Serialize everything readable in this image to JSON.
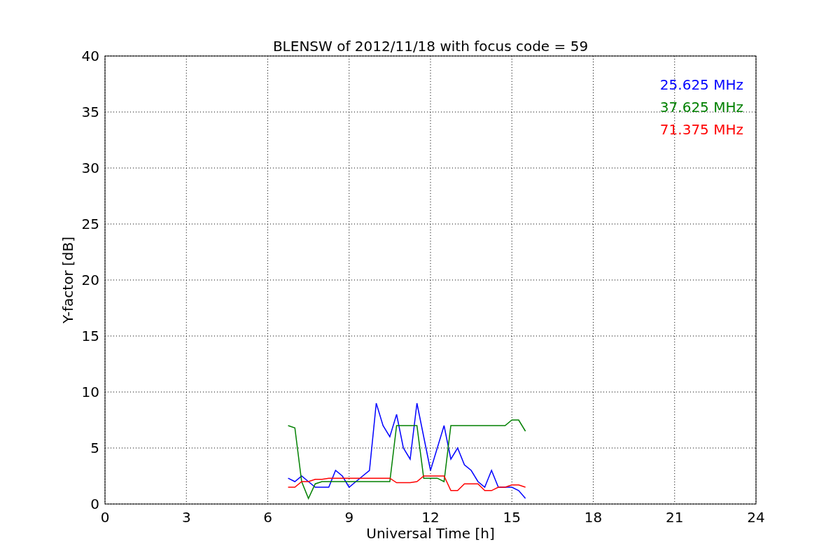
{
  "chart_data": {
    "type": "line",
    "title": "BLENSW of 2012/11/18 with focus code = 59",
    "xlabel": "Universal Time [h]",
    "ylabel": "Y-factor [dB]",
    "xlim": [
      0,
      24
    ],
    "ylim": [
      0,
      40
    ],
    "xticks": [
      0,
      3,
      6,
      9,
      12,
      15,
      18,
      21,
      24
    ],
    "yticks": [
      0,
      5,
      10,
      15,
      20,
      25,
      30,
      35,
      40
    ],
    "grid": true,
    "x": [
      6.75,
      7,
      7.25,
      7.5,
      7.75,
      8,
      8.25,
      8.5,
      8.75,
      9,
      9.25,
      9.5,
      9.75,
      10,
      10.25,
      10.5,
      10.75,
      11,
      11.25,
      11.5,
      11.75,
      12,
      12.25,
      12.5,
      12.75,
      13,
      13.25,
      13.5,
      13.75,
      14,
      14.25,
      14.5,
      14.75,
      15,
      15.25,
      15.5
    ],
    "series": [
      {
        "name": "25.625 MHz",
        "color": "#0000ff",
        "values": [
          2.3,
          2,
          2.5,
          2,
          1.5,
          1.5,
          1.5,
          3,
          2.5,
          1.5,
          2,
          2.5,
          3,
          9,
          7,
          6,
          8,
          5,
          4,
          9,
          6,
          3,
          5,
          7,
          4,
          5,
          3.5,
          3,
          2,
          1.5,
          3,
          1.5,
          1.5,
          1.5,
          1.2,
          0.5
        ]
      },
      {
        "name": "37.625 MHz",
        "color": "#008000",
        "values": [
          7,
          6.8,
          2,
          0.5,
          1.8,
          2,
          2,
          2,
          2,
          2,
          2,
          2,
          2,
          2,
          2,
          2,
          7,
          7,
          7,
          7,
          2.3,
          2.3,
          2.3,
          2,
          7,
          7,
          7,
          7,
          7,
          7,
          7,
          7,
          7,
          7.5,
          7.5,
          6.5
        ]
      },
      {
        "name": "71.375 MHz",
        "color": "#ff0000",
        "values": [
          1.5,
          1.5,
          2,
          2,
          2.2,
          2.2,
          2.3,
          2.3,
          2.3,
          2.3,
          2.3,
          2.3,
          2.3,
          2.3,
          2.3,
          2.3,
          1.9,
          1.9,
          1.9,
          2,
          2.5,
          2.5,
          2.5,
          2.5,
          1.2,
          1.2,
          1.8,
          1.8,
          1.8,
          1.2,
          1.2,
          1.5,
          1.5,
          1.7,
          1.7,
          1.5
        ]
      }
    ]
  }
}
